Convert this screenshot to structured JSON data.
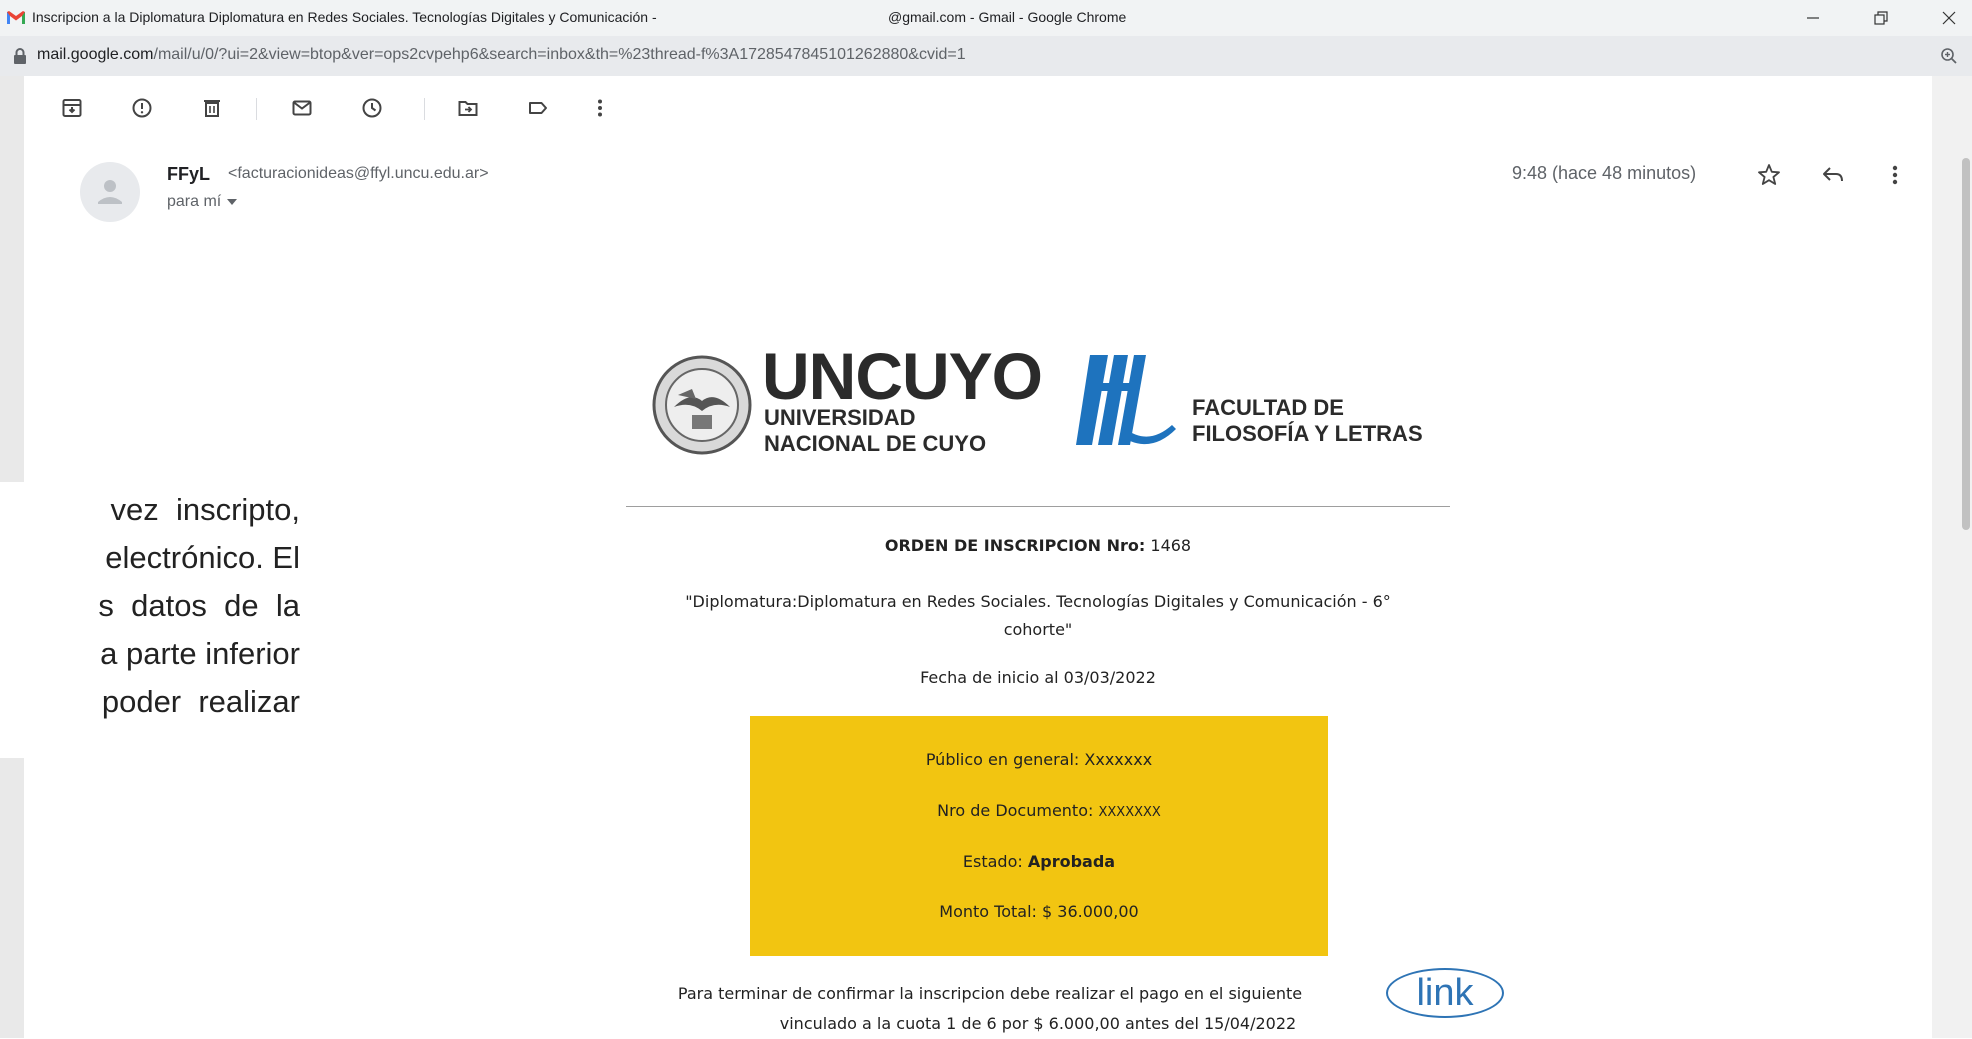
{
  "window": {
    "title_main": "Inscripcion a la Diplomatura Diplomatura en Redes Sociales. Tecnologías Digitales y Comunicación -",
    "title_account": "@gmail.com - Gmail - Google Chrome"
  },
  "address_bar": {
    "domain": "mail.google.com",
    "path": "/mail/u/0/?ui=2&view=btop&ver=ops2cvpehp6&search=inbox&th=%23thread-f%3A1728547845101262880&cvid=1"
  },
  "toolbar": {
    "icons": [
      "archive-icon",
      "report-spam-icon",
      "delete-icon",
      "mark-unread-icon",
      "snooze-icon",
      "move-to-icon",
      "label-icon",
      "more-vert-icon"
    ]
  },
  "message": {
    "sender_name": "FFyL",
    "sender_email": "<facturacionideas@ffyl.uncu.edu.ar>",
    "recipient": "para mí",
    "timestamp": "9:48 (hace 48 minutos)"
  },
  "logos": {
    "uncuyo_main": "UNCUYO",
    "uncuyo_line1": "UNIVERSIDAD",
    "uncuyo_line2": "NACIONAL DE CUYO",
    "ffyl_line1": "FACULTAD DE",
    "ffyl_line2": "FILOSOFÍA Y LETRAS"
  },
  "email_body": {
    "order_label": "ORDEN DE INSCRIPCION Nro:",
    "order_number": "1468",
    "course_line1": "\"Diplomatura:Diplomatura en Redes Sociales. Tecnologías Digitales y Comunicación - 6°",
    "course_line2": "cohorte\"",
    "start_date": "Fecha de inicio al 03/03/2022",
    "box": {
      "public_label": "Público en general:",
      "public_value": "Xxxxxxx",
      "doc_label": "Nro de Documento:",
      "doc_value": "XXXXXXX",
      "status_label": "Estado:",
      "status_value": "Aprobada",
      "total_label": "Monto Total:",
      "total_value": "$ 36.000,00"
    },
    "footer_line1": "Para terminar de confirmar la inscripcion debe realizar el pago en el siguiente",
    "footer_line2": "vinculado a la cuota 1 de 6 por $ 6.000,00 antes del 15/04/2022",
    "link_text": "link"
  },
  "overlay_text": {
    "line1": "vez  inscripto,",
    "line2": "electrónico. El",
    "line3": "s  datos  de  la",
    "line4": "a parte inferior",
    "line5": "poder  realizar"
  },
  "colors": {
    "box_background": "#f2c511",
    "link_accent": "#2e74b5"
  }
}
